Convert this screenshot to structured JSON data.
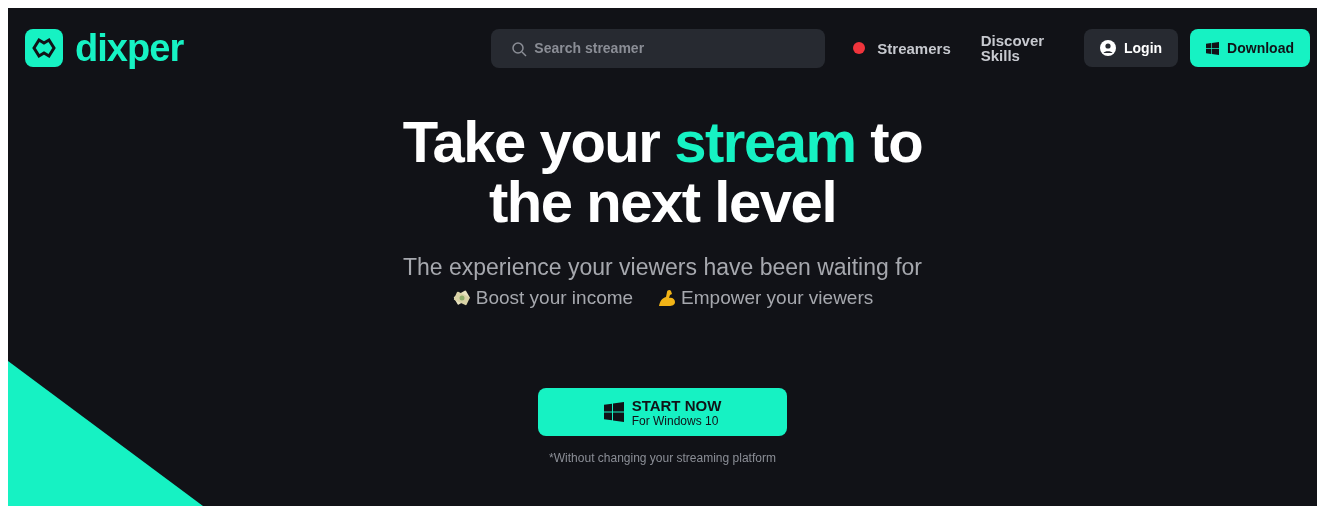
{
  "header": {
    "logo": "dixper",
    "search": {
      "placeholder": "Search streamer"
    },
    "nav": [
      {
        "label": "Streamers",
        "live": true
      },
      {
        "label": "Discover Skills",
        "live": false
      }
    ],
    "login": "Login",
    "download": "Download"
  },
  "hero": {
    "headline": [
      [
        {
          "text": "Take your ",
          "highlight": false
        },
        {
          "text": "stream",
          "highlight": true
        },
        {
          "text": " to",
          "highlight": false
        }
      ],
      [
        {
          "text": "the next level",
          "highlight": false
        }
      ]
    ],
    "subtitle": "The experience your viewers have been waiting for",
    "features": [
      {
        "kind": "money",
        "label": "Boost your income"
      },
      {
        "kind": "arm",
        "label": "Empower your viewers"
      }
    ],
    "cta": {
      "title": "START NOW",
      "subtitle": "For Windows 10"
    },
    "footnote": "*Without changing your streaming platform"
  }
}
